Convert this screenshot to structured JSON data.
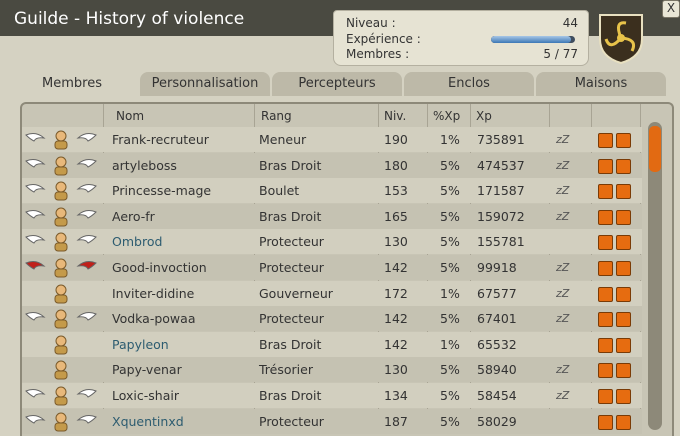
{
  "window": {
    "title": "Guilde - History of violence",
    "close_label": "X"
  },
  "info": {
    "level_label": "Niveau :",
    "level_value": "44",
    "xp_label": "Expérience :",
    "xp_progress": 0.95,
    "members_label": "Membres :",
    "members_value": "5 / 77"
  },
  "tabs": [
    "Membres",
    "Personnalisation",
    "Percepteurs",
    "Enclos",
    "Maisons"
  ],
  "columns": [
    "Nom",
    "Rang",
    "Niv.",
    "%Xp",
    "Xp"
  ],
  "rows": [
    {
      "name": "Frank-recruteur",
      "rank": "Meneur",
      "level": "190",
      "pxp": "1%",
      "xp": "735891",
      "wings": "white",
      "online": false,
      "zz": true
    },
    {
      "name": "artyleboss",
      "rank": "Bras Droit",
      "level": "180",
      "pxp": "5%",
      "xp": "474537",
      "wings": "white",
      "online": false,
      "zz": true
    },
    {
      "name": "Princesse-mage",
      "rank": "Boulet",
      "level": "153",
      "pxp": "5%",
      "xp": "171587",
      "wings": "white",
      "online": false,
      "zz": true
    },
    {
      "name": "Aero-fr",
      "rank": "Bras Droit",
      "level": "165",
      "pxp": "5%",
      "xp": "159072",
      "wings": "white",
      "online": false,
      "zz": true
    },
    {
      "name": "Ombrod",
      "rank": "Protecteur",
      "level": "130",
      "pxp": "5%",
      "xp": "155781",
      "wings": "white",
      "online": true,
      "zz": false
    },
    {
      "name": "Good-invoction",
      "rank": "Protecteur",
      "level": "142",
      "pxp": "5%",
      "xp": "99918",
      "wings": "red",
      "online": false,
      "zz": true
    },
    {
      "name": "Inviter-didine",
      "rank": "Gouverneur",
      "level": "172",
      "pxp": "1%",
      "xp": "67577",
      "wings": "none",
      "online": false,
      "zz": true
    },
    {
      "name": "Vodka-powaa",
      "rank": "Protecteur",
      "level": "142",
      "pxp": "5%",
      "xp": "67401",
      "wings": "white",
      "online": false,
      "zz": true
    },
    {
      "name": "Papyleon",
      "rank": "Bras Droit",
      "level": "142",
      "pxp": "1%",
      "xp": "65532",
      "wings": "none",
      "online": true,
      "zz": false
    },
    {
      "name": "Papy-venar",
      "rank": "Trésorier",
      "level": "130",
      "pxp": "5%",
      "xp": "58940",
      "wings": "none",
      "online": false,
      "zz": true
    },
    {
      "name": "Loxic-shair",
      "rank": "Bras Droit",
      "level": "134",
      "pxp": "5%",
      "xp": "58454",
      "wings": "white",
      "online": false,
      "zz": true
    },
    {
      "name": "Xquentinxd",
      "rank": "Protecteur",
      "level": "187",
      "pxp": "5%",
      "xp": "58029",
      "wings": "white",
      "online": true,
      "zz": false
    }
  ],
  "colors": {
    "online_name": "#2d5c70",
    "offline_name": "#333333",
    "accent": "#e66c10"
  }
}
